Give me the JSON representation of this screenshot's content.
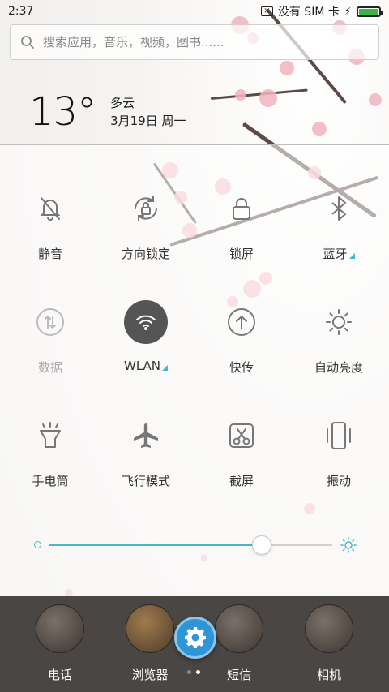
{
  "status_bar": {
    "time": "2:37",
    "carrier": "没有 SIM 卡",
    "battery_level": 1.0,
    "battery_color": "#3cb44a"
  },
  "search": {
    "placeholder": "搜索应用，音乐，视频，图书......"
  },
  "weather": {
    "temperature": "13°",
    "condition": "多云",
    "date": "3月19日 周一"
  },
  "toggles": [
    {
      "label": "静音",
      "icon": "bell-off-icon",
      "state": "off"
    },
    {
      "label": "方向锁定",
      "icon": "rotation-lock-icon",
      "state": "off"
    },
    {
      "label": "锁屏",
      "icon": "lock-icon",
      "state": "off"
    },
    {
      "label": "蓝牙",
      "icon": "bluetooth-icon",
      "state": "off",
      "has_submenu": true
    },
    {
      "label": "数据",
      "icon": "data-icon",
      "state": "disabled"
    },
    {
      "label": "WLAN",
      "icon": "wifi-icon",
      "state": "on",
      "has_submenu": true
    },
    {
      "label": "快传",
      "icon": "upload-icon",
      "state": "off"
    },
    {
      "label": "自动亮度",
      "icon": "sun-icon",
      "state": "off"
    },
    {
      "label": "手电筒",
      "icon": "flashlight-icon",
      "state": "off"
    },
    {
      "label": "飞行模式",
      "icon": "airplane-icon",
      "state": "off"
    },
    {
      "label": "截屏",
      "icon": "screenshot-icon",
      "state": "off"
    },
    {
      "label": "振动",
      "icon": "vibrate-icon",
      "state": "off"
    }
  ],
  "brightness": {
    "level": 0.75,
    "accent": "#4ab6c9"
  },
  "dock": {
    "apps": [
      {
        "label": "电话"
      },
      {
        "label": "浏览器"
      },
      {
        "label": "短信"
      },
      {
        "label": "相机"
      }
    ],
    "settings_icon": "gear-icon",
    "page_count": 2,
    "current_page": 2
  }
}
